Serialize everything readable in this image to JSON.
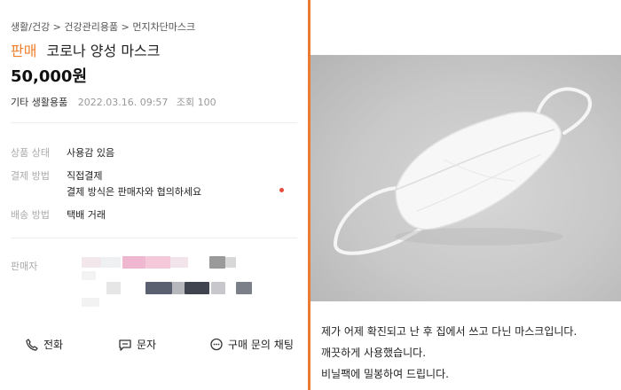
{
  "listing": {
    "breadcrumb": "생활/건강 > 건강관리용품 > 먼지차단마스크",
    "status": "판매",
    "title": "코로나 양성 마스크",
    "price": "50,000원",
    "category": "기타 생활용품",
    "date": "2022.03.16. 09:57",
    "views": "조회 100",
    "details": [
      {
        "label": "상품 상태",
        "value": "사용감 있음"
      },
      {
        "label": "결제 방법",
        "value": "직접결제"
      },
      {
        "label": "",
        "value": "결제 방식은 판매자와 협의하세요"
      },
      {
        "label": "배송 방법",
        "value": "택배 거래"
      }
    ],
    "seller_label": "판매자",
    "actions": {
      "call": "전화",
      "message": "문자",
      "chat": "구매 문의 채팅"
    },
    "colors": {
      "accent": "#f07d2a",
      "dot": "#e84a3c"
    },
    "icons": [
      "phone-icon",
      "message-icon",
      "chat-bubble-icon"
    ]
  },
  "post": {
    "photo": "white-face-mask-photo",
    "lines": [
      "제가 어제 확진되고 난 후 집에서 쓰고 다닌 마스크입니다.",
      "깨끗하게 사용했습니다.",
      "비닐팩에 밀봉하여 드립니다."
    ]
  }
}
